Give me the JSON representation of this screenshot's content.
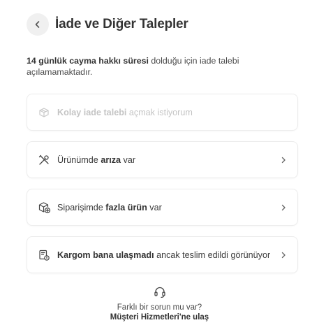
{
  "header": {
    "back_icon": "chevron-left-icon",
    "title": "İade ve Diğer Talepler"
  },
  "notice": {
    "bold": "14 günlük cayma hakkı süresi",
    "rest": " dolduğu için iade talebi açılamamaktadır."
  },
  "options": [
    {
      "icon": "box-return-icon",
      "bold": "Kolay iade talebi",
      "after": " açmak istiyorum",
      "disabled": true
    },
    {
      "icon": "tools-icon",
      "before": "Ürünümde ",
      "bold": "arıza",
      "after": " var",
      "disabled": false
    },
    {
      "icon": "package-plus-icon",
      "before": "Siparişimde ",
      "bold": "fazla ürün",
      "after": " var",
      "disabled": false
    },
    {
      "icon": "delivery-warning-icon",
      "bold": "Kargom bana ulaşmadı",
      "after": " ancak teslim edildi görünüyor",
      "disabled": false
    }
  ],
  "footer": {
    "icon": "headset-icon",
    "question": "Farklı bir sorun mu var?",
    "link": "Müşteri Hizmetleri'ne ulaş"
  }
}
